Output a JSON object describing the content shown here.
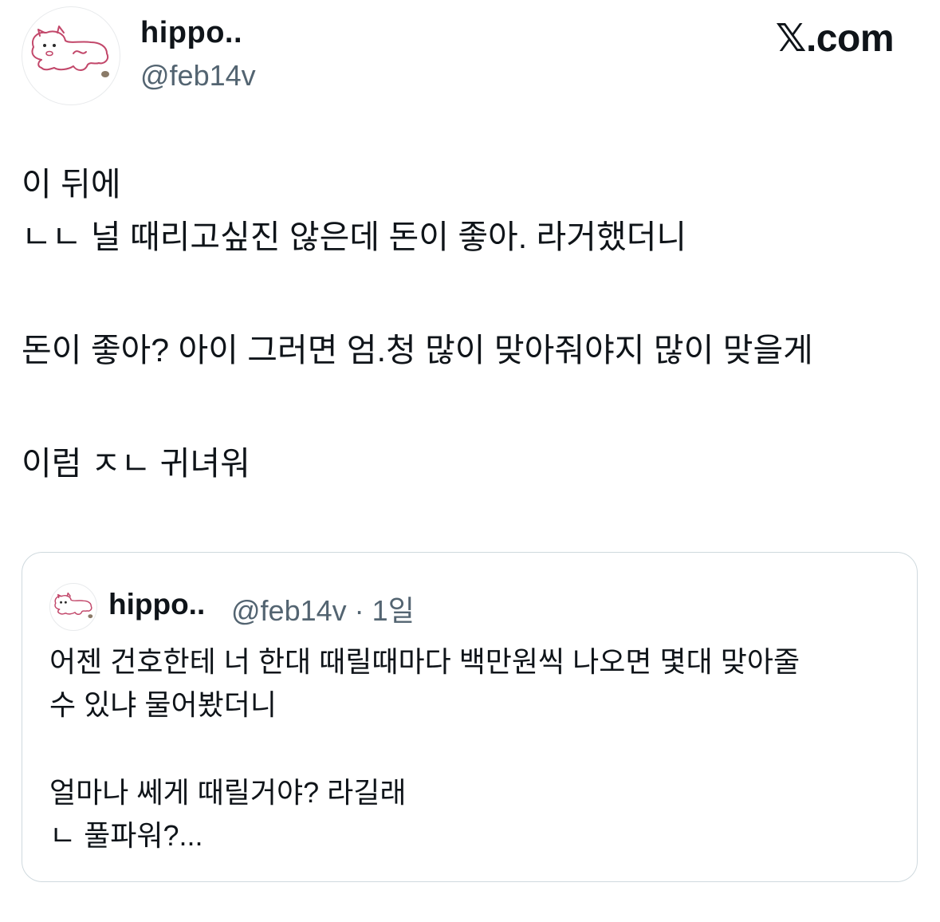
{
  "author": {
    "display_name": "hippo..",
    "handle": "@feb14v",
    "avatar_icon": "hippo-drawing-icon"
  },
  "brand": {
    "logo_text": "𝕏.com"
  },
  "tweet": {
    "lines": [
      "이 뒤에",
      "ㄴㄴ 널 때리고싶진 않은데 돈이 좋아. 라거했더니",
      "돈이 좋아? 아이 그러면 엄.청 많이 맞아줘야지 많이 맞을게",
      "이럼 ㅈㄴ 귀녀워"
    ]
  },
  "quoted_tweet": {
    "display_name": "hippo..",
    "handle": "@feb14v",
    "separator": "·",
    "time": "1일",
    "lines": [
      "어젠 건호한테 너 한대 때릴때마다 백만원씩 나오면 몇대 맞아줄",
      "수 있냐 물어봤더니",
      "얼마나 쎄게 때릴거야? 라길래",
      "ㄴ 풀파워?..."
    ]
  },
  "colors": {
    "text": "#0f1419",
    "secondary": "#536471",
    "border": "#cfd9de",
    "avatar_stroke": "#c2476a"
  }
}
